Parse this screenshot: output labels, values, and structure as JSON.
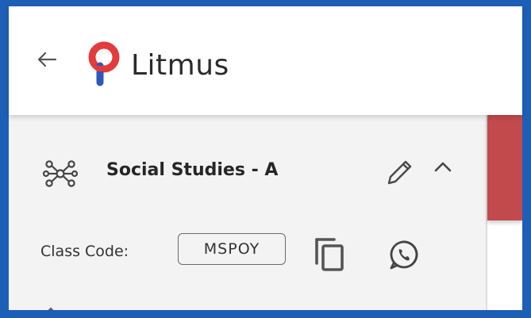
{
  "header": {
    "brand_name": "Litmus",
    "back_icon": "arrow-left-icon",
    "logo_icon": "litmus-logo-icon"
  },
  "class_card": {
    "name": "Social Studies - A",
    "group_icon": "network-nodes-icon",
    "edit_icon": "pencil-icon",
    "collapse_icon": "chevron-up-icon",
    "code_label": "Class Code:",
    "code_value": "MSPOY",
    "copy_icon": "copy-icon",
    "share_icon": "whatsapp-icon"
  },
  "colors": {
    "frame_border": "#1d5fb6",
    "logo_red": "#e23b3b",
    "logo_blue": "#2f57b8",
    "accent_block": "#c24a4c",
    "panel_bg": "#f3f3f3",
    "text_dark": "#262626"
  }
}
